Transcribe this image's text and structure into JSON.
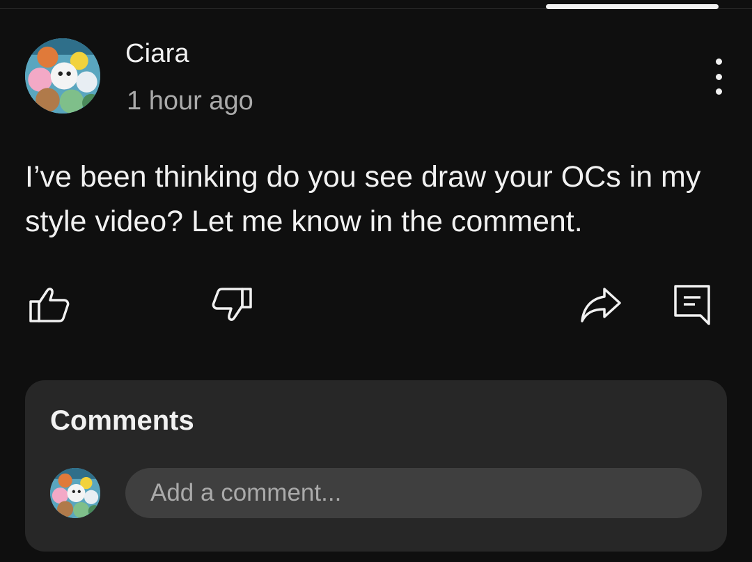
{
  "post": {
    "author": "Ciara",
    "timestamp": "1 hour ago",
    "text": "I’ve been thinking do you see draw your OCs in my style video? Let me know in the comment."
  },
  "actions": {
    "icons": [
      "thumbs-up-icon",
      "thumbs-down-icon",
      "share-icon",
      "comment-icon"
    ]
  },
  "comments": {
    "title": "Comments",
    "input_placeholder": "Add a comment..."
  },
  "theme": {
    "background": "#0f0f0f",
    "panel": "#272727",
    "input": "#3f3f3f",
    "text_primary": "#f1f1f1",
    "text_secondary": "#aaaaaa"
  }
}
